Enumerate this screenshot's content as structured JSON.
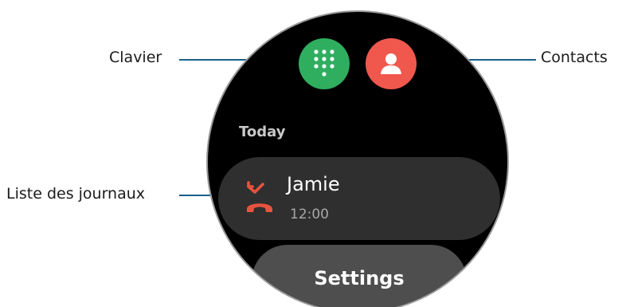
{
  "callouts": {
    "keypad": "Clavier",
    "contacts": "Contacts",
    "log_list": "Liste des journaux"
  },
  "watch": {
    "section_label": "Today",
    "log_items": [
      {
        "name": "Jamie",
        "time": "12:00",
        "call_type": "missed"
      }
    ],
    "settings_label": "Settings"
  },
  "icons": {
    "keypad": "keypad-icon",
    "contacts": "person-icon",
    "missed_call": "missed-call-icon"
  },
  "colors": {
    "keypad_button": "#2fae5f",
    "contacts_button": "#f0584e",
    "missed_call": "#e8533f",
    "callout_line": "#1a5f8c",
    "background": "#000000"
  }
}
